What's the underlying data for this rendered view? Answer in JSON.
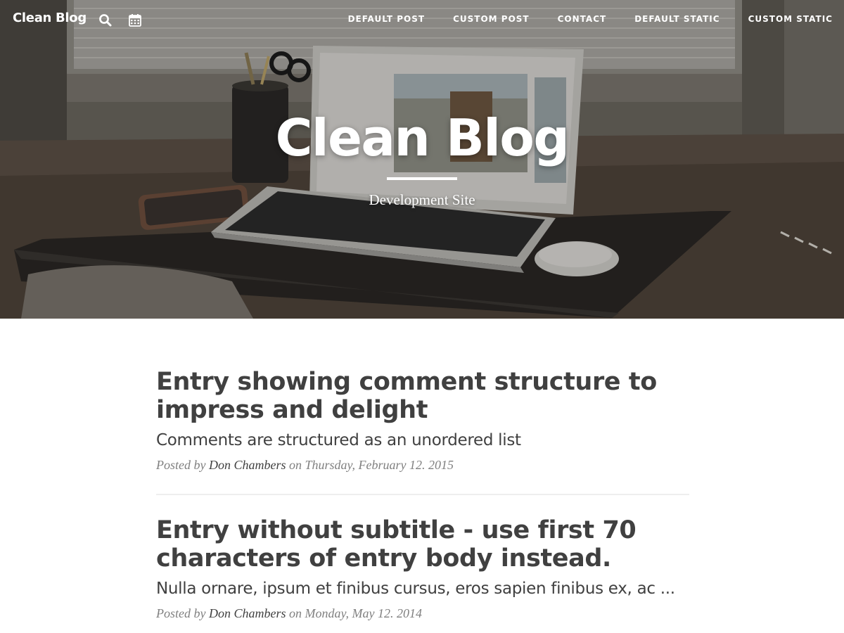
{
  "navbar": {
    "brand": "Clean Blog",
    "icons": {
      "search": "search-icon",
      "calendar": "calendar-icon"
    },
    "links": [
      "Default Post",
      "Custom Post",
      "Contact",
      "Default Static",
      "Custom Static"
    ]
  },
  "hero": {
    "title": "Clean Blog",
    "subtitle": "Development Site"
  },
  "posts": [
    {
      "title": "Entry showing comment structure to impress and delight",
      "subtitle": "Comments are structured as an unordered list",
      "meta_prefix": "Posted by",
      "author": "Don Chambers",
      "meta_on": "on",
      "date": "Thursday, February 12. 2015"
    },
    {
      "title": "Entry without subtitle - use first 70 characters of entry body instead.",
      "subtitle": "Nulla ornare, ipsum et finibus cursus, eros sapien finibus ex, ac ...",
      "meta_prefix": "Posted by",
      "author": "Don Chambers",
      "meta_on": "on",
      "date": "Monday, May 12. 2014"
    }
  ],
  "colors": {
    "heading": "#404040",
    "meta": "#808080",
    "nav_text": "#ffffff",
    "rule": "#eeeeee"
  }
}
